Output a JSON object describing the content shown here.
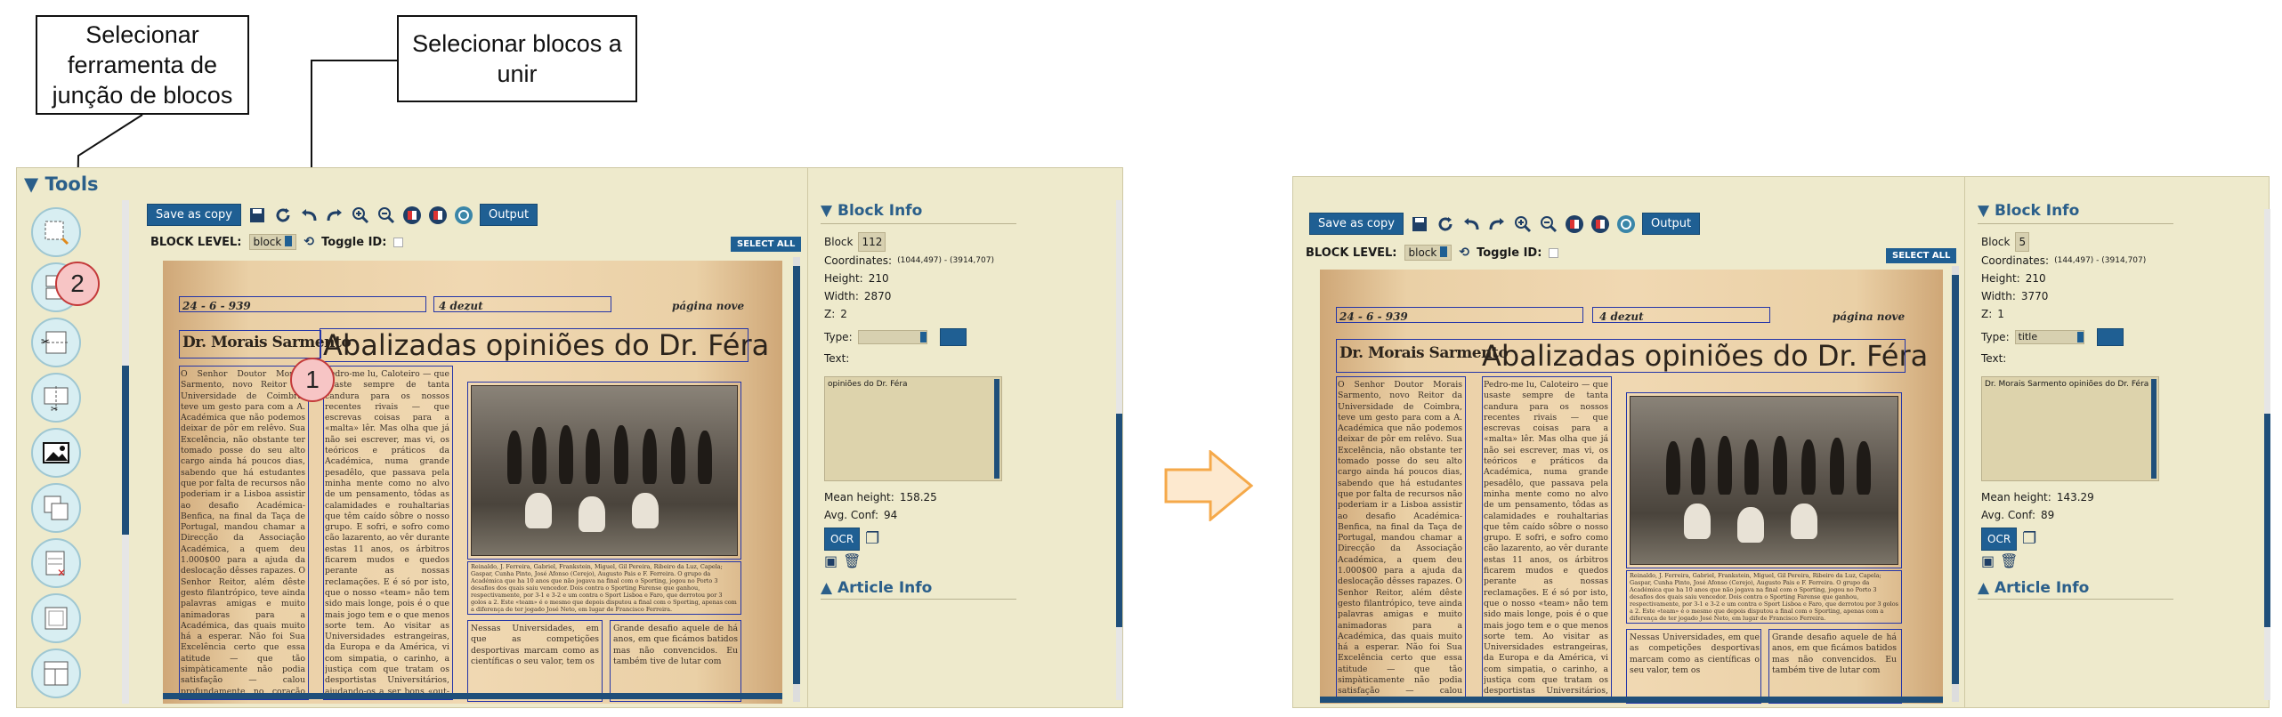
{
  "callouts": {
    "tool_callout": "Selecionar ferramenta de junção de blocos",
    "blocks_callout": "Selecionar blocos a unir",
    "badge_1": "1",
    "badge_2": "2"
  },
  "tools": {
    "title": "▼ Tools",
    "items": [
      "select-tool-icon",
      "merge-blocks-icon",
      "split-horizontal-icon",
      "split-vertical-icon",
      "image-block-icon",
      "overlap-blocks-icon",
      "delete-blocks-icon",
      "frame-block-icon",
      "layout-grid-icon"
    ]
  },
  "toolbar": {
    "save_label": "Save as copy",
    "output_label": "Output"
  },
  "blockbar": {
    "level_label": "BLOCK LEVEL:",
    "level_value": "block",
    "toggle_label": "Toggle ID:",
    "select_all": "SELECT ALL"
  },
  "paper": {
    "date": "24 - 6 - 939",
    "stamp": "4 dezut",
    "page": "página nove",
    "author": "Dr. Morais Sarmento",
    "headline": "Abalizadas opiniões do Dr. Féra",
    "col1": "O Senhor Doutor Morais Sarmento, novo Reitor da Universidade de Coimbra, teve um gesto para com a A. Académica que não podemos deixar de pôr em relêvo. Sua Excelência, não obstante ter tomado posse do seu alto cargo ainda há poucos dias, sabendo que há estudantes que por falta de recursos não poderiam ir a Lisboa assistir ao desafio Académica-Benfica, na final da Taça de Portugal, mandou chamar a Direcção da Associação Académica, a quem deu 1.000$00 para a ajuda da deslocação dêsses rapazes. O Senhor Reitor, além dêste gesto filantrópico, teve ainda palavras amigas e muito animadoras para a Académica, das quais muito há a esperar. Não foi Sua Excelência certo que essa atitude — que tão simpàticamente não podia satisfação — calou profundamente no coração de todos os estudantes.",
    "col2": "Pedro-me lu, Caloteiro — que usaste sempre de tanta candura para os nossos recentes rivais — que escrevas coisas para a «malta» lêr. Mas olha que já não sei escrever, mas vi, os teóricos e práticos da Académica, numa grande pesadêlo, que passava pela minha mente como no alvo de um pensamento, tôdas as calamidades e rouhaltarias que têm caído sôbre o nosso grupo. E sofri, e sofro como cão lazarento, ao vêr durante estas 11 anos, os árbitros ficarem mudos e quedos perante as nossas reclamações. E é só por isto, que o nosso «team» não tem sido mais longe, pois é o que mais jogo tem e o que menos sorte tem. Ao visitar as Universidades estrangeiras, da Europa e da América, vi com simpatia, o carinho, a justiça com que tratam os desportistas Universitários, ajudando-os a ser bons «out-sid men» e preparando-os para a luta.",
    "caption": "Reinaldo, J. Ferreira, Gabriel, Frankstein, Miguel, Gil Pereira, Ribeiro da Luz, Capela; Gaspar, Cunha Pinto, José Afonso (Cerejo), Augusto Pais e F. Ferreira. O grupo da Académica que ha 10 anos que não jogava na final com o Sporting, jogou no Porto 3 desafios dos quais saiu vencedor. Dois contra o Sporting Farense que ganhou, respectivamente, por 3-1 e 3-2 e um contra o Sport Lisboa e Faro, que derrotou por 3 golos a 2. Este «team» é o mesmo que depois disputou a final com o Sporting, apenas com a diferença de ter jogado José Neto, em lugar de Francisco Ferreira.",
    "col3": "Nessas Universidades, em que as competições desportivas marcam como as científicas o seu valor, tem os",
    "col4": "Grande desafio aquele de há anos, em que ficámos batidos mas não convencidos. Eu também tive de lutar com"
  },
  "panel_left": {
    "title": "▼ Block Info",
    "block_label": "Block",
    "block_value": "112",
    "coords_label": "Coordinates:",
    "coords_value": "(1044,497) - (3914,707)",
    "height_label": "Height:",
    "height_value": "210",
    "width_label": "Width:",
    "width_value": "2870",
    "z_label": "Z:",
    "z_value": "2",
    "type_label": "Type:",
    "type_value": "",
    "text_label": "Text:",
    "text_value": "opiniões do Dr. Féra",
    "mean_height_label": "Mean height:",
    "mean_height_value": "158.25",
    "avg_conf_label": "Avg. Conf:",
    "avg_conf_value": "94",
    "ocr_label": "OCR",
    "article_title": "▲ Article Info"
  },
  "panel_right": {
    "title": "▼ Block Info",
    "block_label": "Block",
    "block_value": "5",
    "coords_label": "Coordinates:",
    "coords_value": "(144,497) - (3914,707)",
    "height_label": "Height:",
    "height_value": "210",
    "width_label": "Width:",
    "width_value": "3770",
    "z_label": "Z:",
    "z_value": "1",
    "type_label": "Type:",
    "type_value": "title",
    "text_label": "Text:",
    "text_value": "Dr. Morais Sarmento opiniões do Dr. Féra",
    "mean_height_label": "Mean height:",
    "mean_height_value": "143.29",
    "avg_conf_label": "Avg. Conf:",
    "avg_conf_value": "89",
    "ocr_label": "OCR",
    "article_title": "▲ Article Info"
  },
  "colors": {
    "app_bg": "#eeeacc",
    "accent_blue": "#1f5f93",
    "bbox_blue": "#2435a8",
    "badge_pink": "#f7c5c5",
    "arrow_orange": "#f5a94a"
  }
}
